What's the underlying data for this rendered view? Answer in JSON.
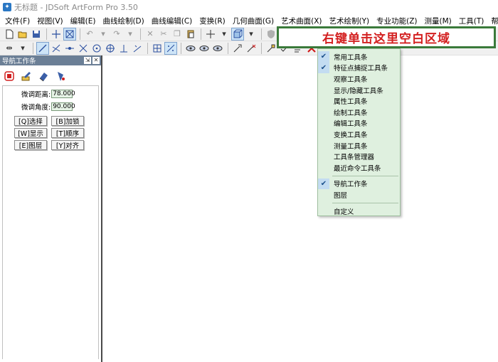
{
  "window": {
    "title": "无标题 - JDSoft ArtForm Pro 3.50",
    "icon": "app-icon"
  },
  "menubar": {
    "items": [
      "文件(F)",
      "视图(V)",
      "编辑(E)",
      "曲线绘制(D)",
      "曲线编辑(C)",
      "变换(R)",
      "几何曲面(G)",
      "艺术曲面(X)",
      "艺术绘制(Y)",
      "专业功能(Z)",
      "测量(M)",
      "工具(T)",
      "帮助(H)"
    ]
  },
  "annotation": {
    "text": "右键单击这里空白区域",
    "border_color": "#3a7a3a",
    "text_color": "#d32020"
  },
  "nav_panel": {
    "title": "导航工作条",
    "pin_icon": "pin-icon",
    "close_icon": "close-icon",
    "fine_distance_label": "微调距离:",
    "fine_distance_value": "78.000",
    "fine_angle_label": "微调角度:",
    "fine_angle_value": "90.000",
    "buttons": [
      "[Q]选择",
      "[B]加锁",
      "[W]显示",
      "[T]顺序",
      "[E]图层",
      "[Y]对齐"
    ]
  },
  "context_menu": {
    "items": [
      {
        "label": "常用工具条",
        "checked": true
      },
      {
        "label": "特征点捕捉工具条",
        "checked": true
      },
      {
        "label": "观察工具条",
        "checked": false
      },
      {
        "label": "显示/隐藏工具条",
        "checked": false
      },
      {
        "label": "属性工具条",
        "checked": false
      },
      {
        "label": "绘制工具条",
        "checked": false
      },
      {
        "label": "编辑工具条",
        "checked": false
      },
      {
        "label": "变换工具条",
        "checked": false
      },
      {
        "label": "测量工具条",
        "checked": false
      },
      {
        "label": "工具条管理器",
        "checked": false
      },
      {
        "label": "最近命令工具条",
        "checked": false
      }
    ],
    "group2": [
      {
        "label": "导航工作条",
        "checked": true
      },
      {
        "label": "图层",
        "checked": false
      }
    ],
    "group3": [
      {
        "label": "自定义",
        "checked": false
      }
    ],
    "check_glyph": "✔"
  },
  "colors": {
    "menu_bg": "#dff0df",
    "check_bg": "#c3dcf1",
    "panel_header": "#6b7f96"
  }
}
